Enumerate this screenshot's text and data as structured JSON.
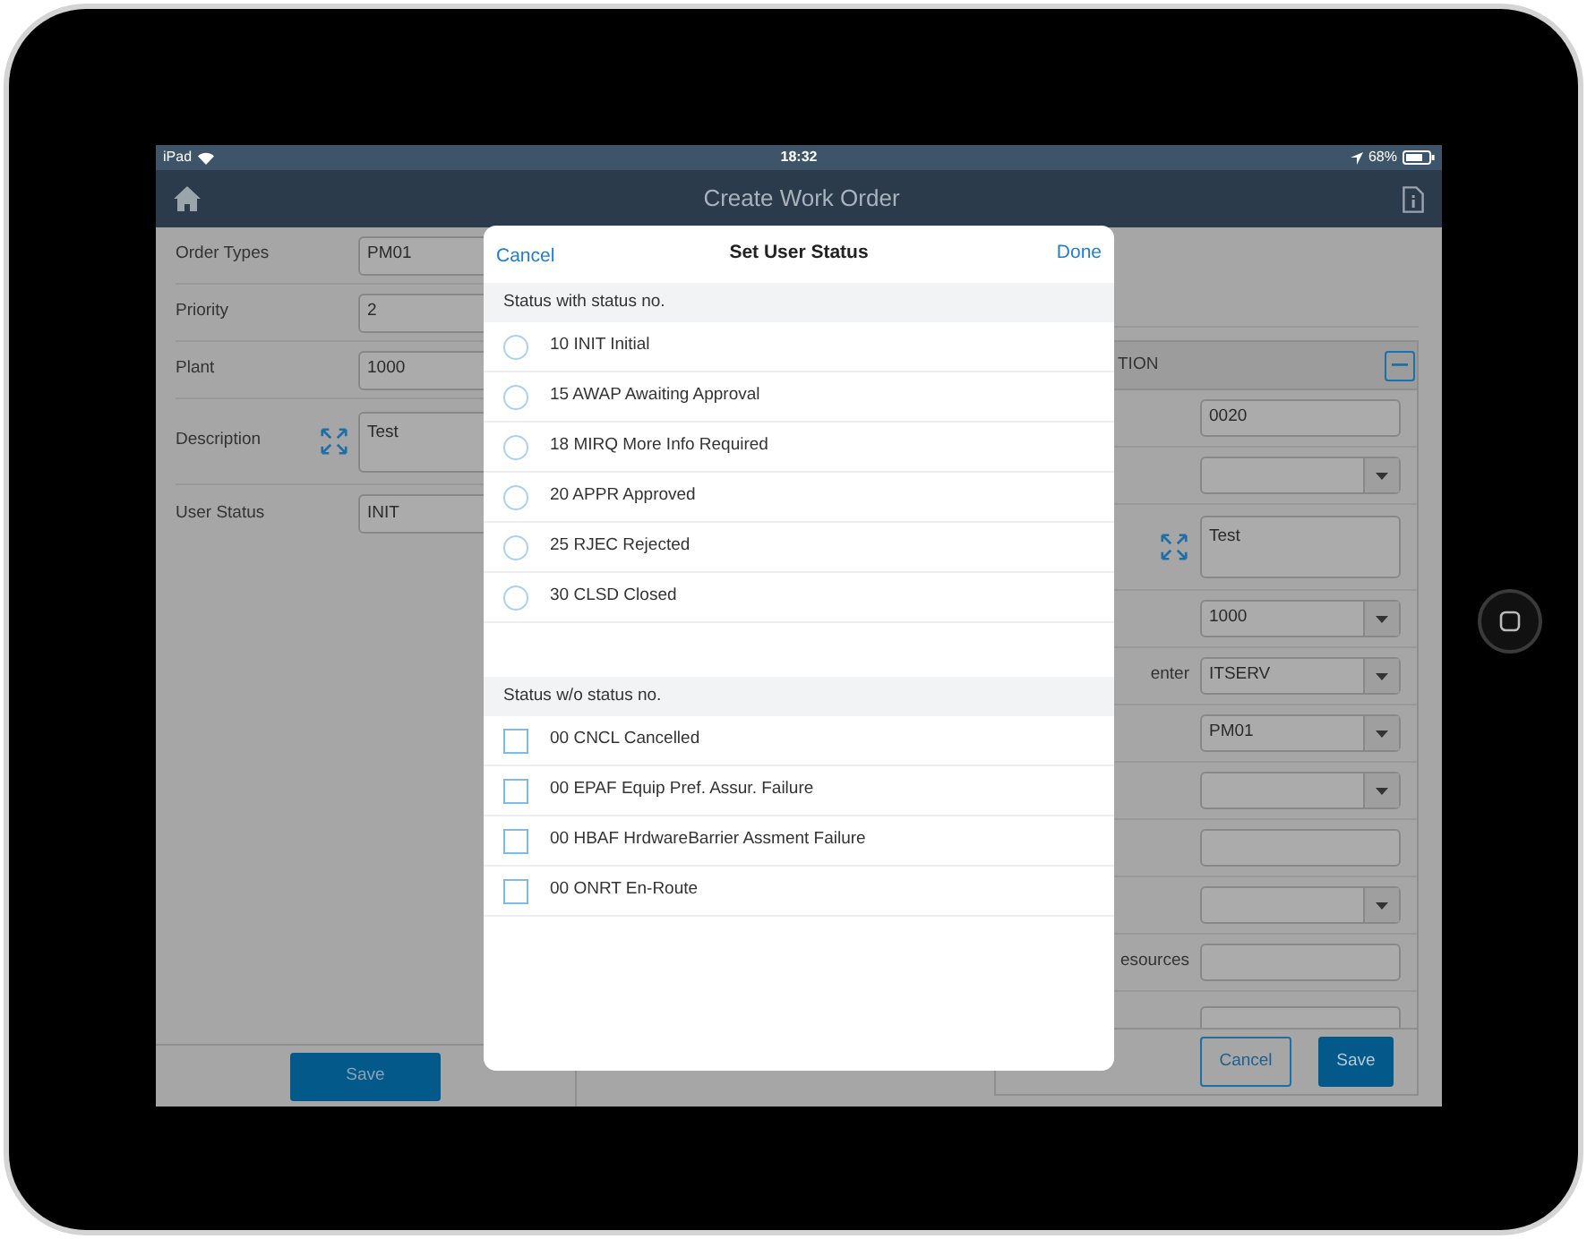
{
  "status_bar": {
    "carrier": "iPad",
    "time": "18:32",
    "battery": "68%"
  },
  "nav_bar": {
    "title": "Create Work Order"
  },
  "form": {
    "fields": [
      {
        "label": "Order Types",
        "value": "PM01",
        "kind": "text"
      },
      {
        "label": "Priority",
        "value": "2",
        "kind": "text"
      },
      {
        "label": "Plant",
        "value": "1000",
        "kind": "text"
      },
      {
        "label": "Description",
        "value": "Test",
        "kind": "textarea"
      },
      {
        "label": "User Status",
        "value": "INIT",
        "kind": "text"
      }
    ],
    "save_button": "Save"
  },
  "details": {
    "section_title": "TION",
    "fields": [
      {
        "value": "0020",
        "kind": "text"
      },
      {
        "kind": "dropdown"
      },
      {
        "value": "Test",
        "kind": "textarea"
      },
      {
        "value": "1000",
        "kind": "dropdown"
      },
      {
        "label": "enter",
        "value": "ITSERV",
        "kind": "dropdown"
      },
      {
        "value": "PM01",
        "kind": "dropdown"
      },
      {
        "kind": "dropdown"
      },
      {
        "kind": "text"
      },
      {
        "kind": "dropdown"
      },
      {
        "label": "esources",
        "kind": "text"
      }
    ],
    "cancel_button": "Cancel",
    "save_button": "Save"
  },
  "modal": {
    "title": "Set User Status",
    "cancel": "Cancel",
    "done": "Done",
    "sections": [
      {
        "title": "Status with status no.",
        "kind": "radio",
        "items": [
          {
            "label": "10 INIT Initial",
            "selected": false
          },
          {
            "label": "15 AWAP Awaiting Approval",
            "selected": false
          },
          {
            "label": "18 MIRQ More Info Required",
            "selected": false
          },
          {
            "label": "20 APPR Approved",
            "selected": false
          },
          {
            "label": "25 RJEC Rejected",
            "selected": false
          },
          {
            "label": "30 CLSD Closed",
            "selected": false
          }
        ]
      },
      {
        "title": "Status w/o status no.",
        "kind": "checkbox",
        "items": [
          {
            "label": "00 CNCL Cancelled",
            "checked": false
          },
          {
            "label": "00 EPAF Equip Pref. Assur. Failure",
            "checked": false
          },
          {
            "label": "00 HBAF HrdwareBarrier Assment Failure",
            "checked": false
          },
          {
            "label": "00 ONRT En-Route",
            "checked": false
          }
        ]
      }
    ]
  }
}
